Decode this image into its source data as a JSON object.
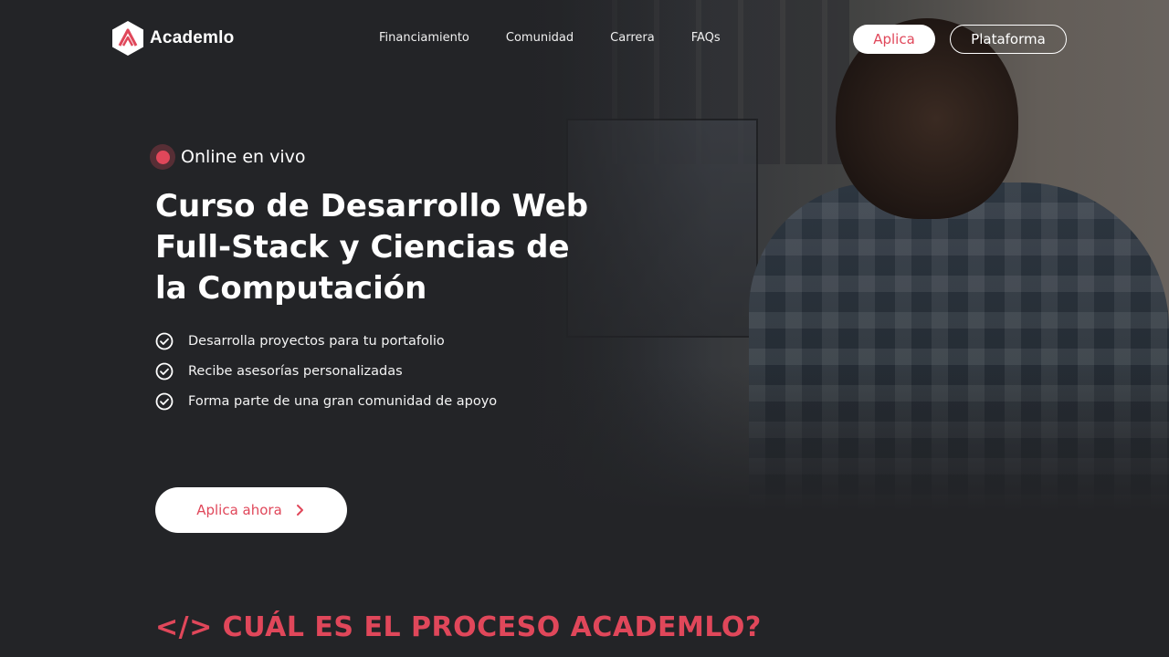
{
  "brand": {
    "name": "Academlo",
    "accent": "#e0475a",
    "background": "#232427"
  },
  "nav": {
    "items": [
      "Financiamiento",
      "Comunidad",
      "Carrera",
      "FAQs"
    ]
  },
  "header_buttons": {
    "apply": "Aplica",
    "platform": "Plataforma"
  },
  "hero": {
    "badge": "Online en vivo",
    "title": "Curso de Desarrollo Web Full-Stack y Ciencias de la Computación",
    "bullets": [
      "Desarrolla proyectos para tu portafolio",
      "Recibe asesorías personalizadas",
      "Forma parte de una gran comunidad de apoyo"
    ],
    "cta": "Aplica ahora"
  },
  "section": {
    "heading": "</> CUÁL ES EL PROCESO ACADEMLO?"
  },
  "icons": [
    "academlo-logo-icon",
    "live-dot-icon",
    "check-circle-icon",
    "chevron-right-icon"
  ]
}
